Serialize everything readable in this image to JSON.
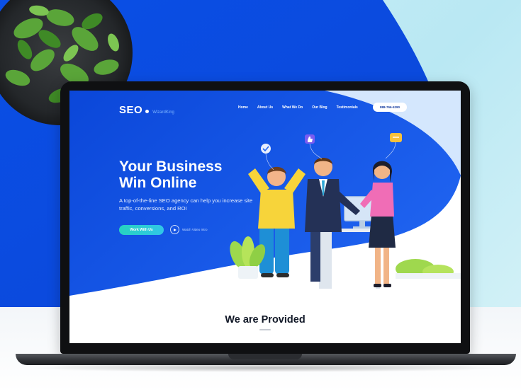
{
  "site": {
    "logo_main": "SEO",
    "logo_sub": "WizardKing",
    "nav": [
      "Home",
      "About Us",
      "What We Do",
      "Our Blog",
      "Testimonials"
    ],
    "phone_button": "888-766-5290",
    "hero_title_line1": "Your Business",
    "hero_title_line2": "Win Online",
    "hero_subtitle": "A top-of-the-line SEO agency can help you increase site traffic, conversions, and ROI",
    "primary_button": "Work With Us",
    "video_button": "Watch Video Intro",
    "section_title": "We are Provided"
  },
  "colors": {
    "hero_blue": "#0a4fe0",
    "hero_blue_light": "#2a6cf2",
    "accent_teal": "#2fd0cc",
    "backdrop_light": "#c6edf5"
  },
  "icons": {
    "plant": "potted-plant",
    "play": "play-icon",
    "like": "thumbs-up-icon",
    "check": "checkmark-icon",
    "chat": "chat-bubble-icon"
  }
}
